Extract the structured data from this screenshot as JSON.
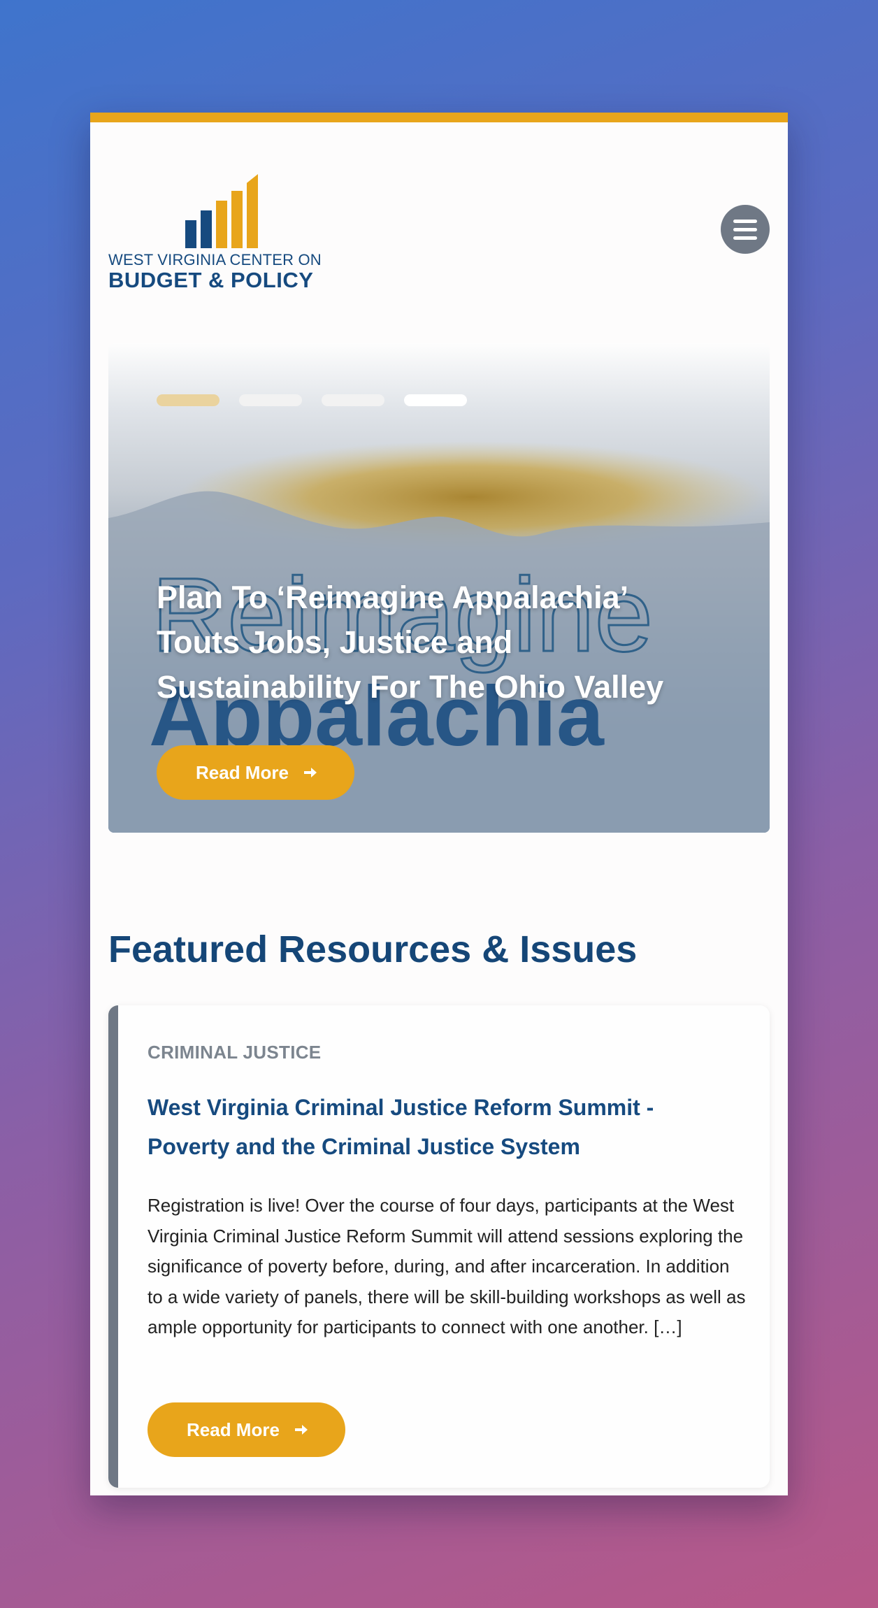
{
  "header": {
    "logo": {
      "line1": "WEST VIRGINIA CENTER ON",
      "line2": "BUDGET & POLICY"
    },
    "menu_icon": "hamburger-icon"
  },
  "hero": {
    "slide_count": 4,
    "active_slide": 4,
    "title": "Plan To ‘Reimagine Appalachia’ Touts Jobs, Justice and Sustainability For The Ohio Valley",
    "art_text": {
      "line1": "Reimagine",
      "line2": "Appalachia"
    },
    "button_label": "Read More",
    "button_icon": "arrow-right-icon"
  },
  "featured": {
    "section_title": "Featured Resources & Issues",
    "card": {
      "category": "CRIMINAL JUSTICE",
      "title": "West Virginia Criminal Justice Reform Summit - Poverty and the Criminal Justice System",
      "body": "Registration is live! Over the course of four days, participants at the West Virginia Criminal Justice Reform Summit will attend sessions exploring the significance of poverty before, during, and after incarceration. In addition to a wide variety of panels, there will be skill-building workshops as well as ample opportunity for participants to connect with one another. […]",
      "button_label": "Read More",
      "button_icon": "arrow-right-icon"
    }
  },
  "colors": {
    "brand_gold": "#e8a51b",
    "brand_blue": "#164a7f",
    "menu_gray": "#6f7885"
  }
}
